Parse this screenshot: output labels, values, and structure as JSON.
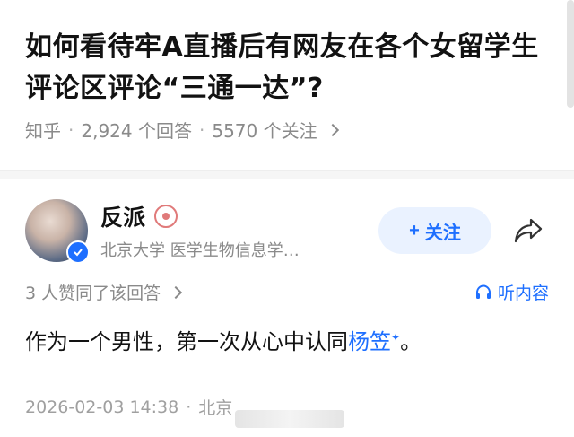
{
  "question": {
    "title": "如何看待牢A直播后有网友在各个女留学生评论区评论“三通一达”?",
    "source": "知乎",
    "answers_count": "2,924 个回答",
    "followers_count": "5570 个关注"
  },
  "answer": {
    "author_name": "反派",
    "author_desc": "北京大学 医学生物信息学…",
    "follow_label": "关注",
    "like_text": "3 人赞同了该回答",
    "listen_label": "听内容",
    "content_plain": "作为一个男性，第一次从心中认同",
    "content_link": "杨笠",
    "content_end": "。",
    "date": "2026-02-03 14:38",
    "location": "北京"
  },
  "icons": {
    "share": "share-icon",
    "headphones": "headphones-icon",
    "verified": "verified-icon",
    "plus": "plus-icon"
  },
  "colors": {
    "accent": "#1e6fff",
    "muted": "#8a8a8a",
    "follow_bg": "#eaf2ff"
  }
}
